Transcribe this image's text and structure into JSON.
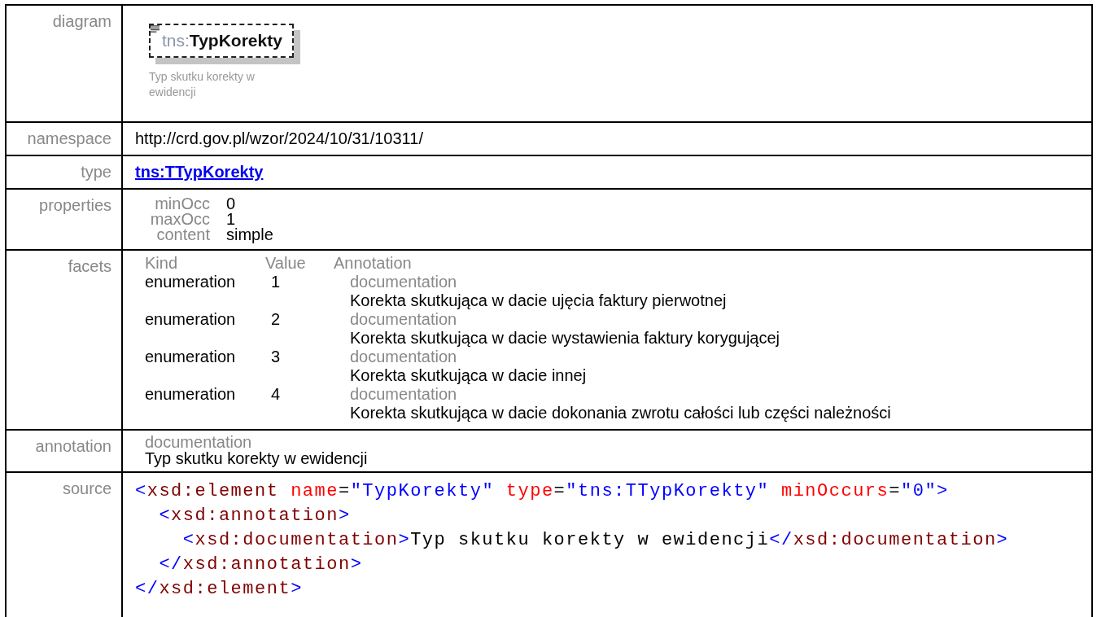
{
  "rows": [
    {
      "kind": "diagram",
      "label": "diagram",
      "prefix": "tns:",
      "name": "TypKorekty",
      "caption": "Typ skutku korekty w ewidencji"
    },
    {
      "kind": "text",
      "label": "namespace",
      "value": "http://crd.gov.pl/wzor/2024/10/31/10311/"
    },
    {
      "kind": "link",
      "label": "type",
      "value": "tns:TTypKorekty"
    },
    {
      "kind": "properties",
      "label": "properties",
      "items": [
        {
          "name": "minOcc",
          "value": "0"
        },
        {
          "name": "maxOcc",
          "value": "1"
        },
        {
          "name": "content",
          "value": "simple"
        }
      ]
    },
    {
      "kind": "facets",
      "label": "facets",
      "columns": [
        "Kind",
        "Value",
        "Annotation"
      ],
      "items": [
        {
          "kind": "enumeration",
          "value": "1",
          "doc_label": "documentation",
          "doc": "Korekta skutkująca w dacie ujęcia faktury pierwotnej"
        },
        {
          "kind": "enumeration",
          "value": "2",
          "doc_label": "documentation",
          "doc": "Korekta skutkująca w dacie wystawienia faktury korygującej"
        },
        {
          "kind": "enumeration",
          "value": "3",
          "doc_label": "documentation",
          "doc": "Korekta skutkująca w dacie innej"
        },
        {
          "kind": "enumeration",
          "value": "4",
          "doc_label": "documentation",
          "doc": "Korekta skutkująca w dacie dokonania zwrotu całości lub części należności"
        }
      ]
    },
    {
      "kind": "annotation",
      "label": "annotation",
      "doc_label": "documentation",
      "doc": "Typ skutku korekty w ewidencji"
    },
    {
      "kind": "source",
      "label": "source",
      "lines": [
        [
          {
            "kind": "punct",
            "text": "<"
          },
          {
            "kind": "tag",
            "text": "xsd:element"
          },
          {
            "kind": "attr",
            "text": " name"
          },
          {
            "kind": "plain",
            "text": "="
          },
          {
            "kind": "value",
            "text": "\"TypKorekty\""
          },
          {
            "kind": "attr",
            "text": " type"
          },
          {
            "kind": "plain",
            "text": "="
          },
          {
            "kind": "value",
            "text": "\"tns:TTypKorekty\""
          },
          {
            "kind": "attr",
            "text": " minOccurs"
          },
          {
            "kind": "plain",
            "text": "="
          },
          {
            "kind": "value",
            "text": "\"0\""
          },
          {
            "kind": "punct",
            "text": ">"
          }
        ],
        [
          {
            "kind": "punct",
            "text": "  <"
          },
          {
            "kind": "tag",
            "text": "xsd:annotation"
          },
          {
            "kind": "punct",
            "text": ">"
          }
        ],
        [
          {
            "kind": "punct",
            "text": "    <"
          },
          {
            "kind": "tag",
            "text": "xsd:documentation"
          },
          {
            "kind": "punct",
            "text": ">"
          },
          {
            "kind": "plain",
            "text": "Typ skutku korekty w ewidencji"
          },
          {
            "kind": "punct",
            "text": "</"
          },
          {
            "kind": "tag",
            "text": "xsd:documentation"
          },
          {
            "kind": "punct",
            "text": ">"
          }
        ],
        [
          {
            "kind": "punct",
            "text": "  </"
          },
          {
            "kind": "tag",
            "text": "xsd:annotation"
          },
          {
            "kind": "punct",
            "text": ">"
          }
        ],
        [
          {
            "kind": "punct",
            "text": "</"
          },
          {
            "kind": "tag",
            "text": "xsd:element"
          },
          {
            "kind": "punct",
            "text": ">"
          }
        ]
      ]
    }
  ]
}
